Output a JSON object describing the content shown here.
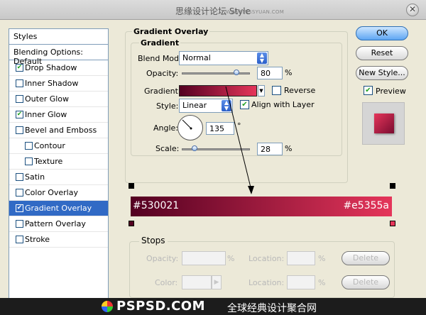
{
  "window": {
    "title": "思缘设计论坛  Style",
    "watermark": "WWW.MISSYUAN.COM"
  },
  "styles": {
    "header": "Styles",
    "blending": "Blending Options: Default",
    "items": [
      {
        "label": "Drop Shadow",
        "checked": true
      },
      {
        "label": "Inner Shadow",
        "checked": false
      },
      {
        "label": "Outer Glow",
        "checked": false
      },
      {
        "label": "Inner Glow",
        "checked": true
      },
      {
        "label": "Bevel and Emboss",
        "checked": false
      },
      {
        "label": "Contour",
        "checked": false
      },
      {
        "label": "Texture",
        "checked": false
      },
      {
        "label": "Satin",
        "checked": false
      },
      {
        "label": "Color Overlay",
        "checked": false
      },
      {
        "label": "Gradient Overlay",
        "checked": true
      },
      {
        "label": "Pattern Overlay",
        "checked": false
      },
      {
        "label": "Stroke",
        "checked": false
      }
    ]
  },
  "gradient_overlay": {
    "title": "Gradient Overlay",
    "section": "Gradient",
    "blend_mode_label": "Blend Mode:",
    "blend_mode": "Normal",
    "opacity_label": "Opacity:",
    "opacity": "80",
    "opacity_unit": "%",
    "gradient_label": "Gradient:",
    "reverse_label": "Reverse",
    "reverse": false,
    "style_label": "Style:",
    "style": "Linear",
    "align_label": "Align with Layer",
    "align": true,
    "angle_label": "Angle:",
    "angle": "135",
    "angle_unit": "°",
    "scale_label": "Scale:",
    "scale": "28",
    "scale_unit": "%"
  },
  "buttons": {
    "ok": "OK",
    "reset": "Reset",
    "new_style": "New Style...",
    "preview_label": "Preview",
    "preview": true
  },
  "gradient_editor": {
    "left_color": "#530021",
    "right_color": "#e5355a",
    "stops_title": "Stops",
    "opacity_label": "Opacity:",
    "color_label": "Color:",
    "location_label": "Location:",
    "percent": "%",
    "delete_label": "Delete"
  },
  "banner": {
    "logo": "PSPSD.COM",
    "subtitle": "全球经典设计聚合网"
  }
}
